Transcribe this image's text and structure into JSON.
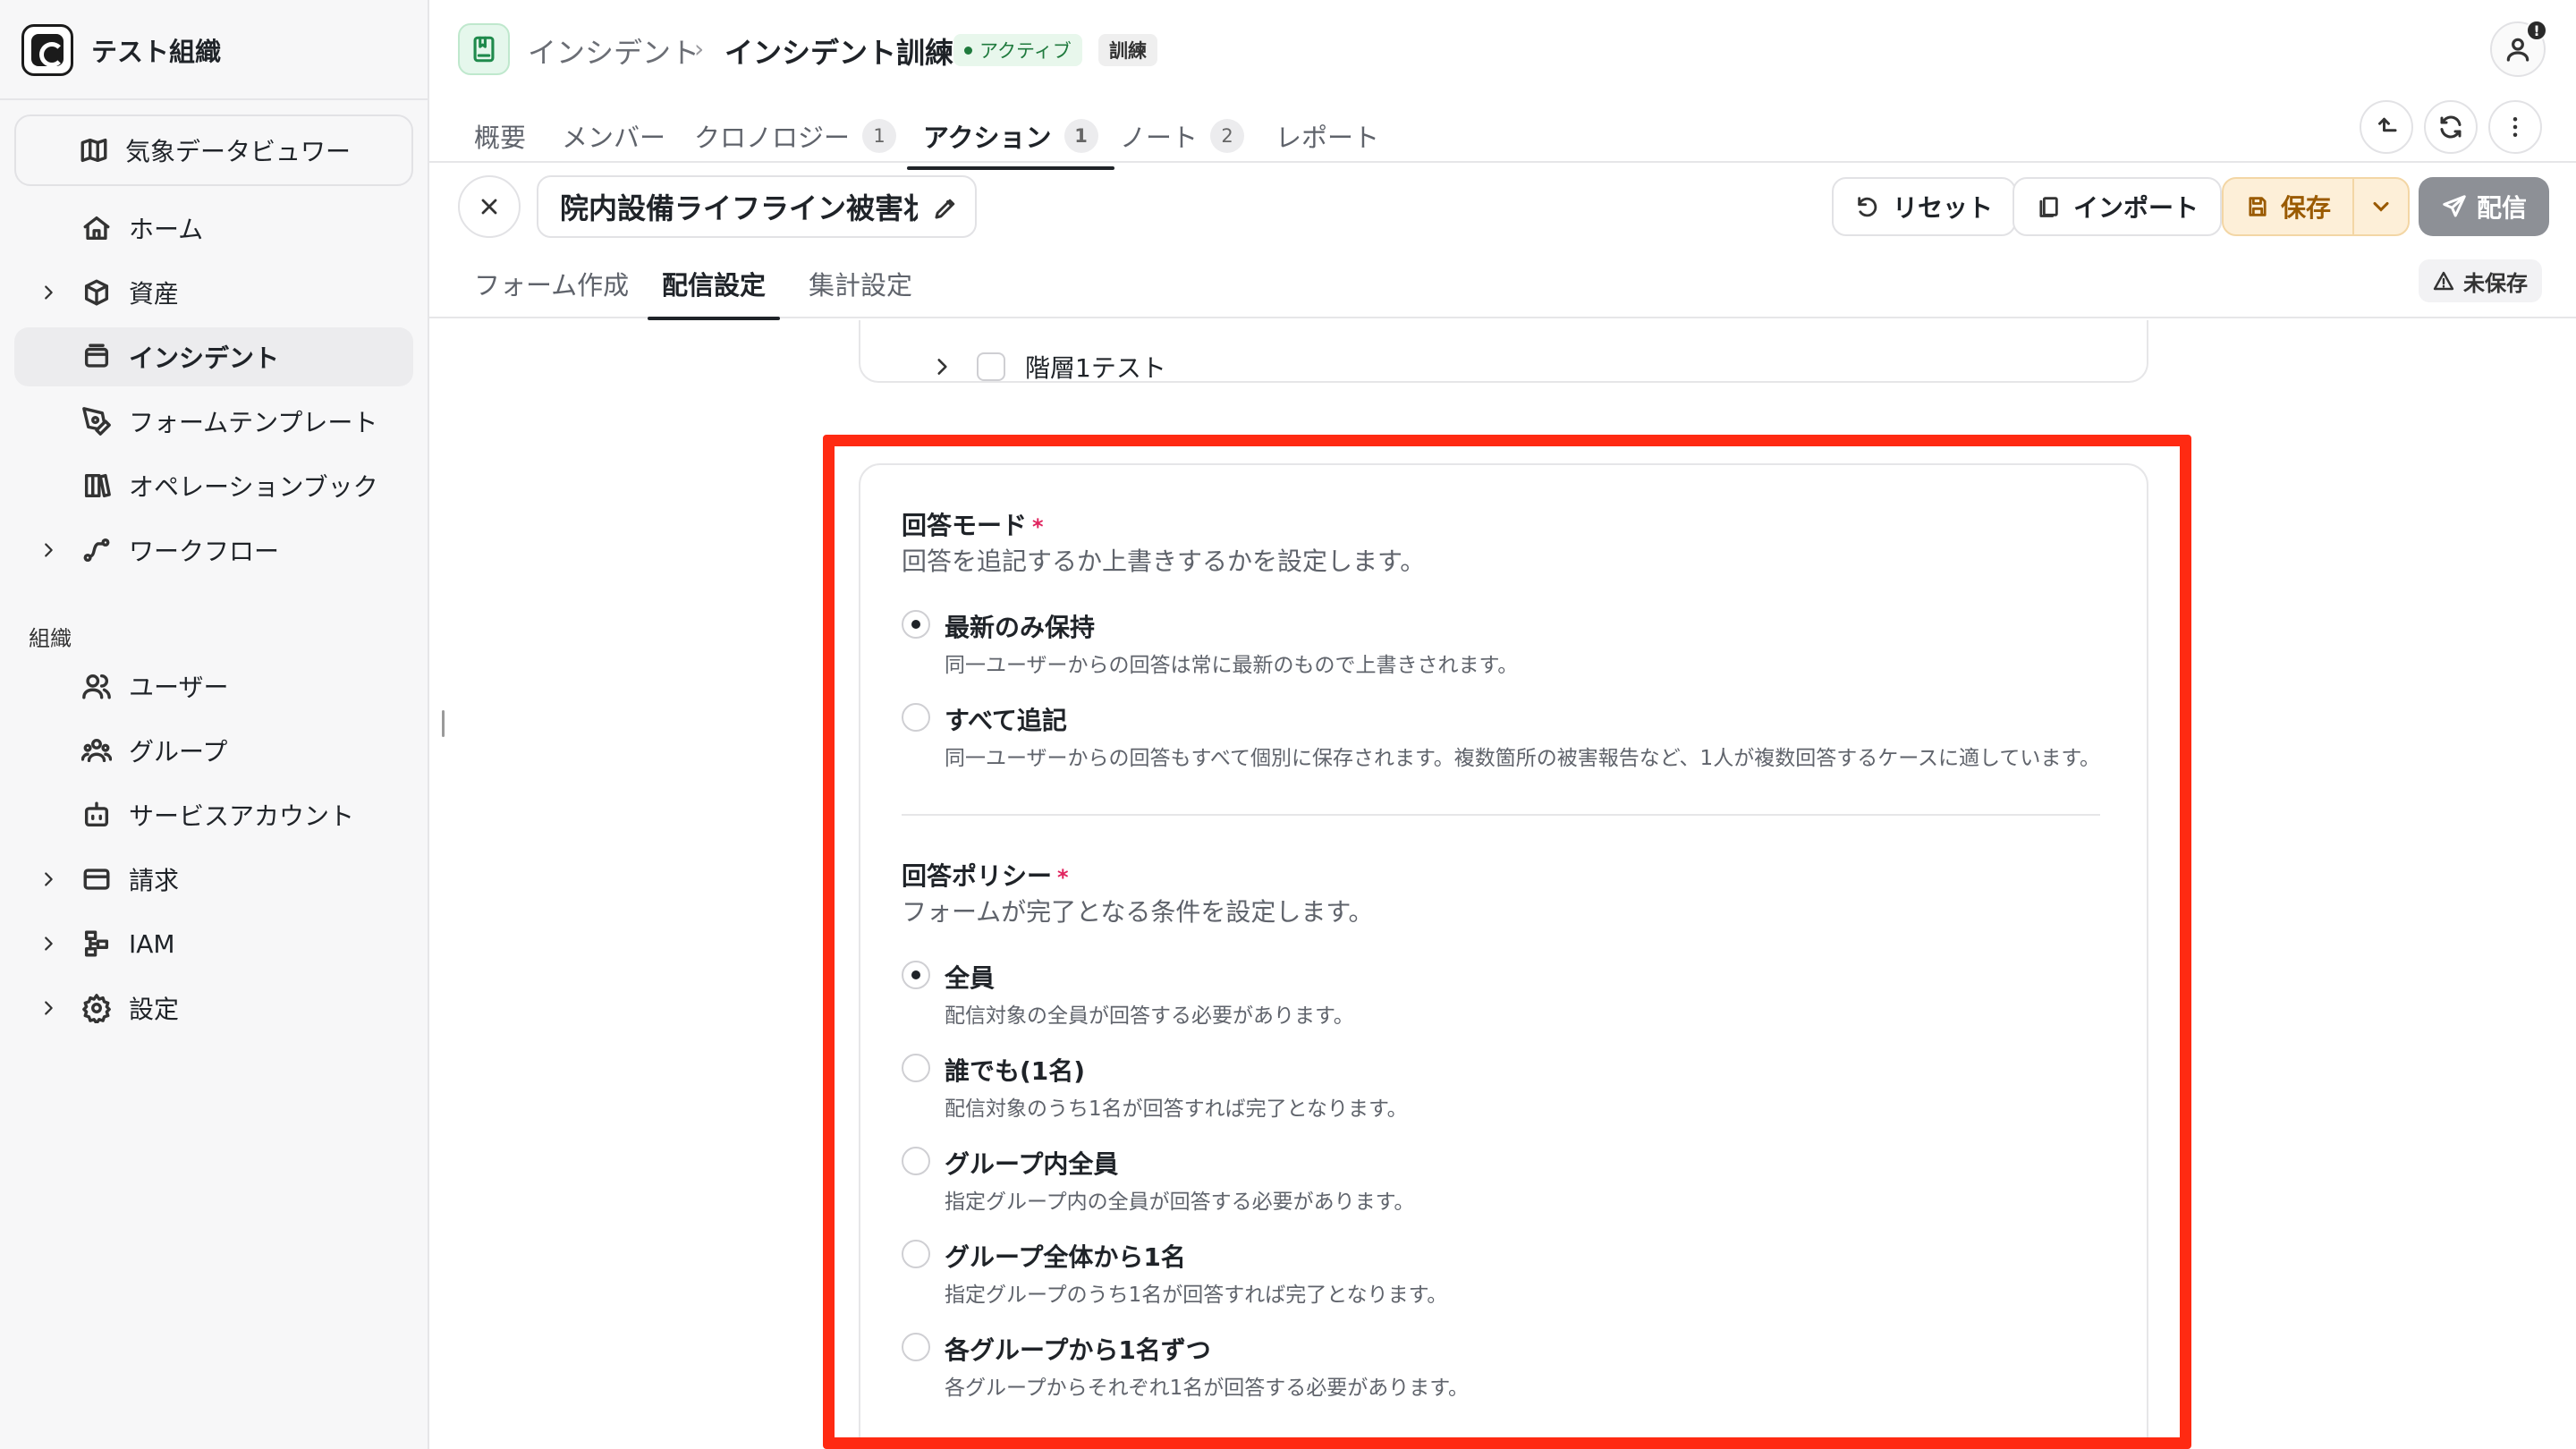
{
  "sidebar": {
    "org_name": "テスト組織",
    "weather_viewer": "気象データビュワー",
    "items": [
      {
        "label": "ホーム",
        "icon": "home-icon"
      },
      {
        "label": "資産",
        "icon": "box-icon"
      },
      {
        "label": "インシデント",
        "icon": "window-icon"
      },
      {
        "label": "フォームテンプレート",
        "icon": "pen-tool-icon"
      },
      {
        "label": "オペレーションブック",
        "icon": "books-icon"
      },
      {
        "label": "ワークフロー",
        "icon": "workflow-icon"
      }
    ],
    "section_org": "組織",
    "org_items": [
      {
        "label": "ユーザー",
        "icon": "users-icon"
      },
      {
        "label": "グループ",
        "icon": "group-icon"
      },
      {
        "label": "サービスアカウント",
        "icon": "bot-icon"
      },
      {
        "label": "請求",
        "icon": "wallet-icon"
      },
      {
        "label": "IAM",
        "icon": "iam-icon"
      },
      {
        "label": "設定",
        "icon": "gear-icon"
      }
    ]
  },
  "header": {
    "breadcrumb_parent": "インシデント",
    "breadcrumb_current": "インシデント訓練",
    "status_badge": "アクティブ",
    "type_badge": "訓練",
    "notification_mark": "!"
  },
  "tabs": [
    {
      "label": "概要",
      "count": null
    },
    {
      "label": "メンバー",
      "count": null
    },
    {
      "label": "クロノロジー",
      "count": "1"
    },
    {
      "label": "アクション",
      "count": "1"
    },
    {
      "label": "ノート",
      "count": "2"
    },
    {
      "label": "レポート",
      "count": null
    }
  ],
  "form": {
    "title": "院内設備ライフライン被害状況",
    "reset": "リセット",
    "import": "インポート",
    "save": "保存",
    "deliver": "配信",
    "unsaved": "未保存",
    "subtabs": [
      "フォーム作成",
      "配信設定",
      "集計設定"
    ]
  },
  "tree": {
    "item_label": "階層1テスト"
  },
  "answer_mode": {
    "title": "回答モード",
    "required_mark": "*",
    "description": "回答を追記するか上書きするかを設定します。",
    "options": [
      {
        "label": "最新のみ保持",
        "desc": "同一ユーザーからの回答は常に最新のもので上書きされます。",
        "selected": true
      },
      {
        "label": "すべて追記",
        "desc": "同一ユーザーからの回答もすべて個別に保存されます。複数箇所の被害報告など、1人が複数回答するケースに適しています。",
        "selected": false
      }
    ]
  },
  "answer_policy": {
    "title": "回答ポリシー",
    "required_mark": "*",
    "description": "フォームが完了となる条件を設定します。",
    "options": [
      {
        "label": "全員",
        "desc": "配信対象の全員が回答する必要があります。",
        "selected": true
      },
      {
        "label": "誰でも(1名)",
        "desc": "配信対象のうち1名が回答すれば完了となります。",
        "selected": false
      },
      {
        "label": "グループ内全員",
        "desc": "指定グループ内の全員が回答する必要があります。",
        "selected": false
      },
      {
        "label": "グループ全体から1名",
        "desc": "指定グループのうち1名が回答すれば完了となります。",
        "selected": false
      },
      {
        "label": "各グループから1名ずつ",
        "desc": "各グループからそれぞれ1名が回答する必要があります。",
        "selected": false
      }
    ]
  },
  "colors": {
    "highlight": "#ff2a12",
    "active_badge": "#1f7a3d",
    "save_button": "#fdefd8",
    "deliver_button": "#8d9096",
    "required": "#e0245e"
  }
}
